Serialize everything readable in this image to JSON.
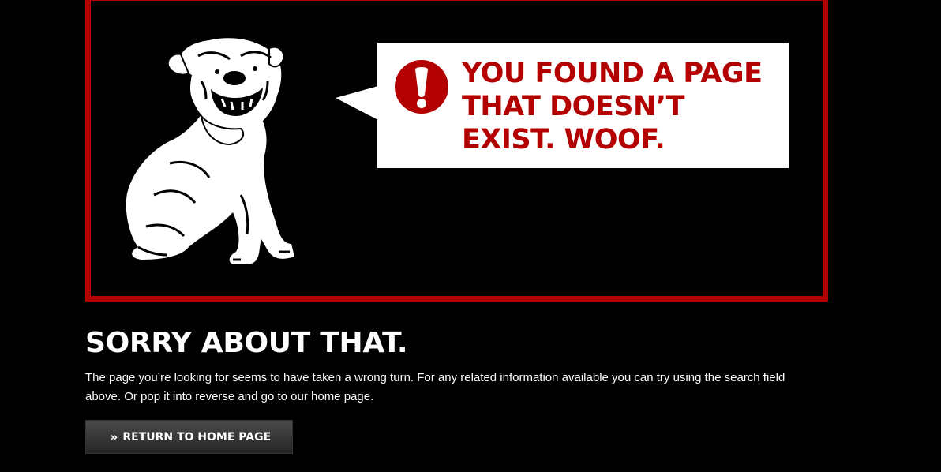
{
  "hero": {
    "headline": "YOU FOUND A PAGE THAT DOESN’T EXIST. WOOF.",
    "illustration": "bulldog",
    "alert_icon": "exclamation-circle-icon",
    "accent_color": "#b30000"
  },
  "main": {
    "title": "SORRY ABOUT THAT.",
    "body": "The page you’re looking for seems to have taken a wrong turn. For any related information available you can try using the search field above. Or pop it into reverse and go to our home page."
  },
  "button": {
    "icon": "double-chevron-right-icon",
    "label": "RETURN TO HOME PAGE"
  }
}
